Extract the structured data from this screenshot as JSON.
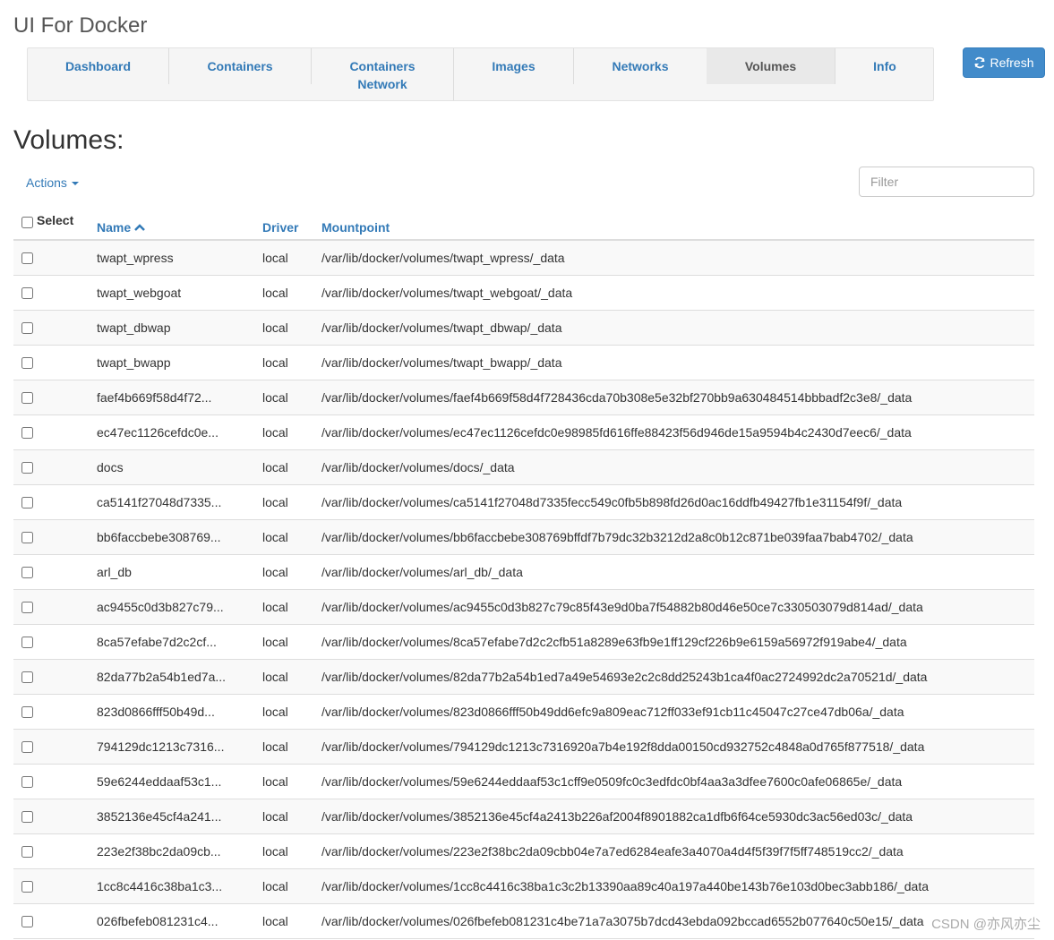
{
  "app": {
    "title": "UI For Docker"
  },
  "nav": {
    "items": [
      {
        "label": "Dashboard",
        "active": false
      },
      {
        "label": "Containers",
        "active": false
      },
      {
        "label": "Containers\nNetwork",
        "active": false
      },
      {
        "label": "Images",
        "active": false
      },
      {
        "label": "Networks",
        "active": false
      },
      {
        "label": "Volumes",
        "active": true
      },
      {
        "label": "Info",
        "active": false
      }
    ]
  },
  "toolbar": {
    "refresh_label": "Refresh"
  },
  "page": {
    "heading": "Volumes:"
  },
  "actions": {
    "label": "Actions"
  },
  "filter": {
    "placeholder": "Filter",
    "value": ""
  },
  "table": {
    "columns": {
      "select": "Select",
      "name": "Name",
      "driver": "Driver",
      "mountpoint": "Mountpoint"
    },
    "rows": [
      {
        "name": "twapt_wpress",
        "driver": "local",
        "mountpoint": "/var/lib/docker/volumes/twapt_wpress/_data"
      },
      {
        "name": "twapt_webgoat",
        "driver": "local",
        "mountpoint": "/var/lib/docker/volumes/twapt_webgoat/_data"
      },
      {
        "name": "twapt_dbwap",
        "driver": "local",
        "mountpoint": "/var/lib/docker/volumes/twapt_dbwap/_data"
      },
      {
        "name": "twapt_bwapp",
        "driver": "local",
        "mountpoint": "/var/lib/docker/volumes/twapt_bwapp/_data"
      },
      {
        "name": "faef4b669f58d4f72...",
        "driver": "local",
        "mountpoint": "/var/lib/docker/volumes/faef4b669f58d4f728436cda70b308e5e32bf270bb9a630484514bbbadf2c3e8/_data"
      },
      {
        "name": "ec47ec1126cefdc0e...",
        "driver": "local",
        "mountpoint": "/var/lib/docker/volumes/ec47ec1126cefdc0e98985fd616ffe88423f56d946de15a9594b4c2430d7eec6/_data"
      },
      {
        "name": "docs",
        "driver": "local",
        "mountpoint": "/var/lib/docker/volumes/docs/_data"
      },
      {
        "name": "ca5141f27048d7335...",
        "driver": "local",
        "mountpoint": "/var/lib/docker/volumes/ca5141f27048d7335fecc549c0fb5b898fd26d0ac16ddfb49427fb1e31154f9f/_data"
      },
      {
        "name": "bb6faccbebe308769...",
        "driver": "local",
        "mountpoint": "/var/lib/docker/volumes/bb6faccbebe308769bffdf7b79dc32b3212d2a8c0b12c871be039faa7bab4702/_data"
      },
      {
        "name": "arl_db",
        "driver": "local",
        "mountpoint": "/var/lib/docker/volumes/arl_db/_data"
      },
      {
        "name": "ac9455c0d3b827c79...",
        "driver": "local",
        "mountpoint": "/var/lib/docker/volumes/ac9455c0d3b827c79c85f43e9d0ba7f54882b80d46e50ce7c330503079d814ad/_data"
      },
      {
        "name": "8ca57efabe7d2c2cf...",
        "driver": "local",
        "mountpoint": "/var/lib/docker/volumes/8ca57efabe7d2c2cfb51a8289e63fb9e1ff129cf226b9e6159a56972f919abe4/_data"
      },
      {
        "name": "82da77b2a54b1ed7a...",
        "driver": "local",
        "mountpoint": "/var/lib/docker/volumes/82da77b2a54b1ed7a49e54693e2c2c8dd25243b1ca4f0ac2724992dc2a70521d/_data"
      },
      {
        "name": "823d0866fff50b49d...",
        "driver": "local",
        "mountpoint": "/var/lib/docker/volumes/823d0866fff50b49dd6efc9a809eac712ff033ef91cb11c45047c27ce47db06a/_data"
      },
      {
        "name": "794129dc1213c7316...",
        "driver": "local",
        "mountpoint": "/var/lib/docker/volumes/794129dc1213c7316920a7b4e192f8dda00150cd932752c4848a0d765f877518/_data"
      },
      {
        "name": "59e6244eddaaf53c1...",
        "driver": "local",
        "mountpoint": "/var/lib/docker/volumes/59e6244eddaaf53c1cff9e0509fc0c3edfdc0bf4aa3a3dfee7600c0afe06865e/_data"
      },
      {
        "name": "3852136e45cf4a241...",
        "driver": "local",
        "mountpoint": "/var/lib/docker/volumes/3852136e45cf4a2413b226af2004f8901882ca1dfb6f64ce5930dc3ac56ed03c/_data"
      },
      {
        "name": "223e2f38bc2da09cb...",
        "driver": "local",
        "mountpoint": "/var/lib/docker/volumes/223e2f38bc2da09cbb04e7a7ed6284eafe3a4070a4d4f5f39f7f5ff748519cc2/_data"
      },
      {
        "name": "1cc8c4416c38ba1c3...",
        "driver": "local",
        "mountpoint": "/var/lib/docker/volumes/1cc8c4416c38ba1c3c2b13390aa89c40a197a440be143b76e103d0bec3abb186/_data"
      },
      {
        "name": "026fbefeb081231c4...",
        "driver": "local",
        "mountpoint": "/var/lib/docker/volumes/026fbefeb081231c4be71a7a3075b7dcd43ebda092bccad6552b077640c50e15/_data"
      }
    ]
  },
  "watermark": {
    "text": "CSDN @亦风亦尘"
  },
  "colors": {
    "link": "#337ab7",
    "primary": "#428bca"
  },
  "icons": {
    "refresh": "refresh-icon",
    "sort": "chevron-up-icon",
    "dropdown": "caret-down-icon"
  }
}
